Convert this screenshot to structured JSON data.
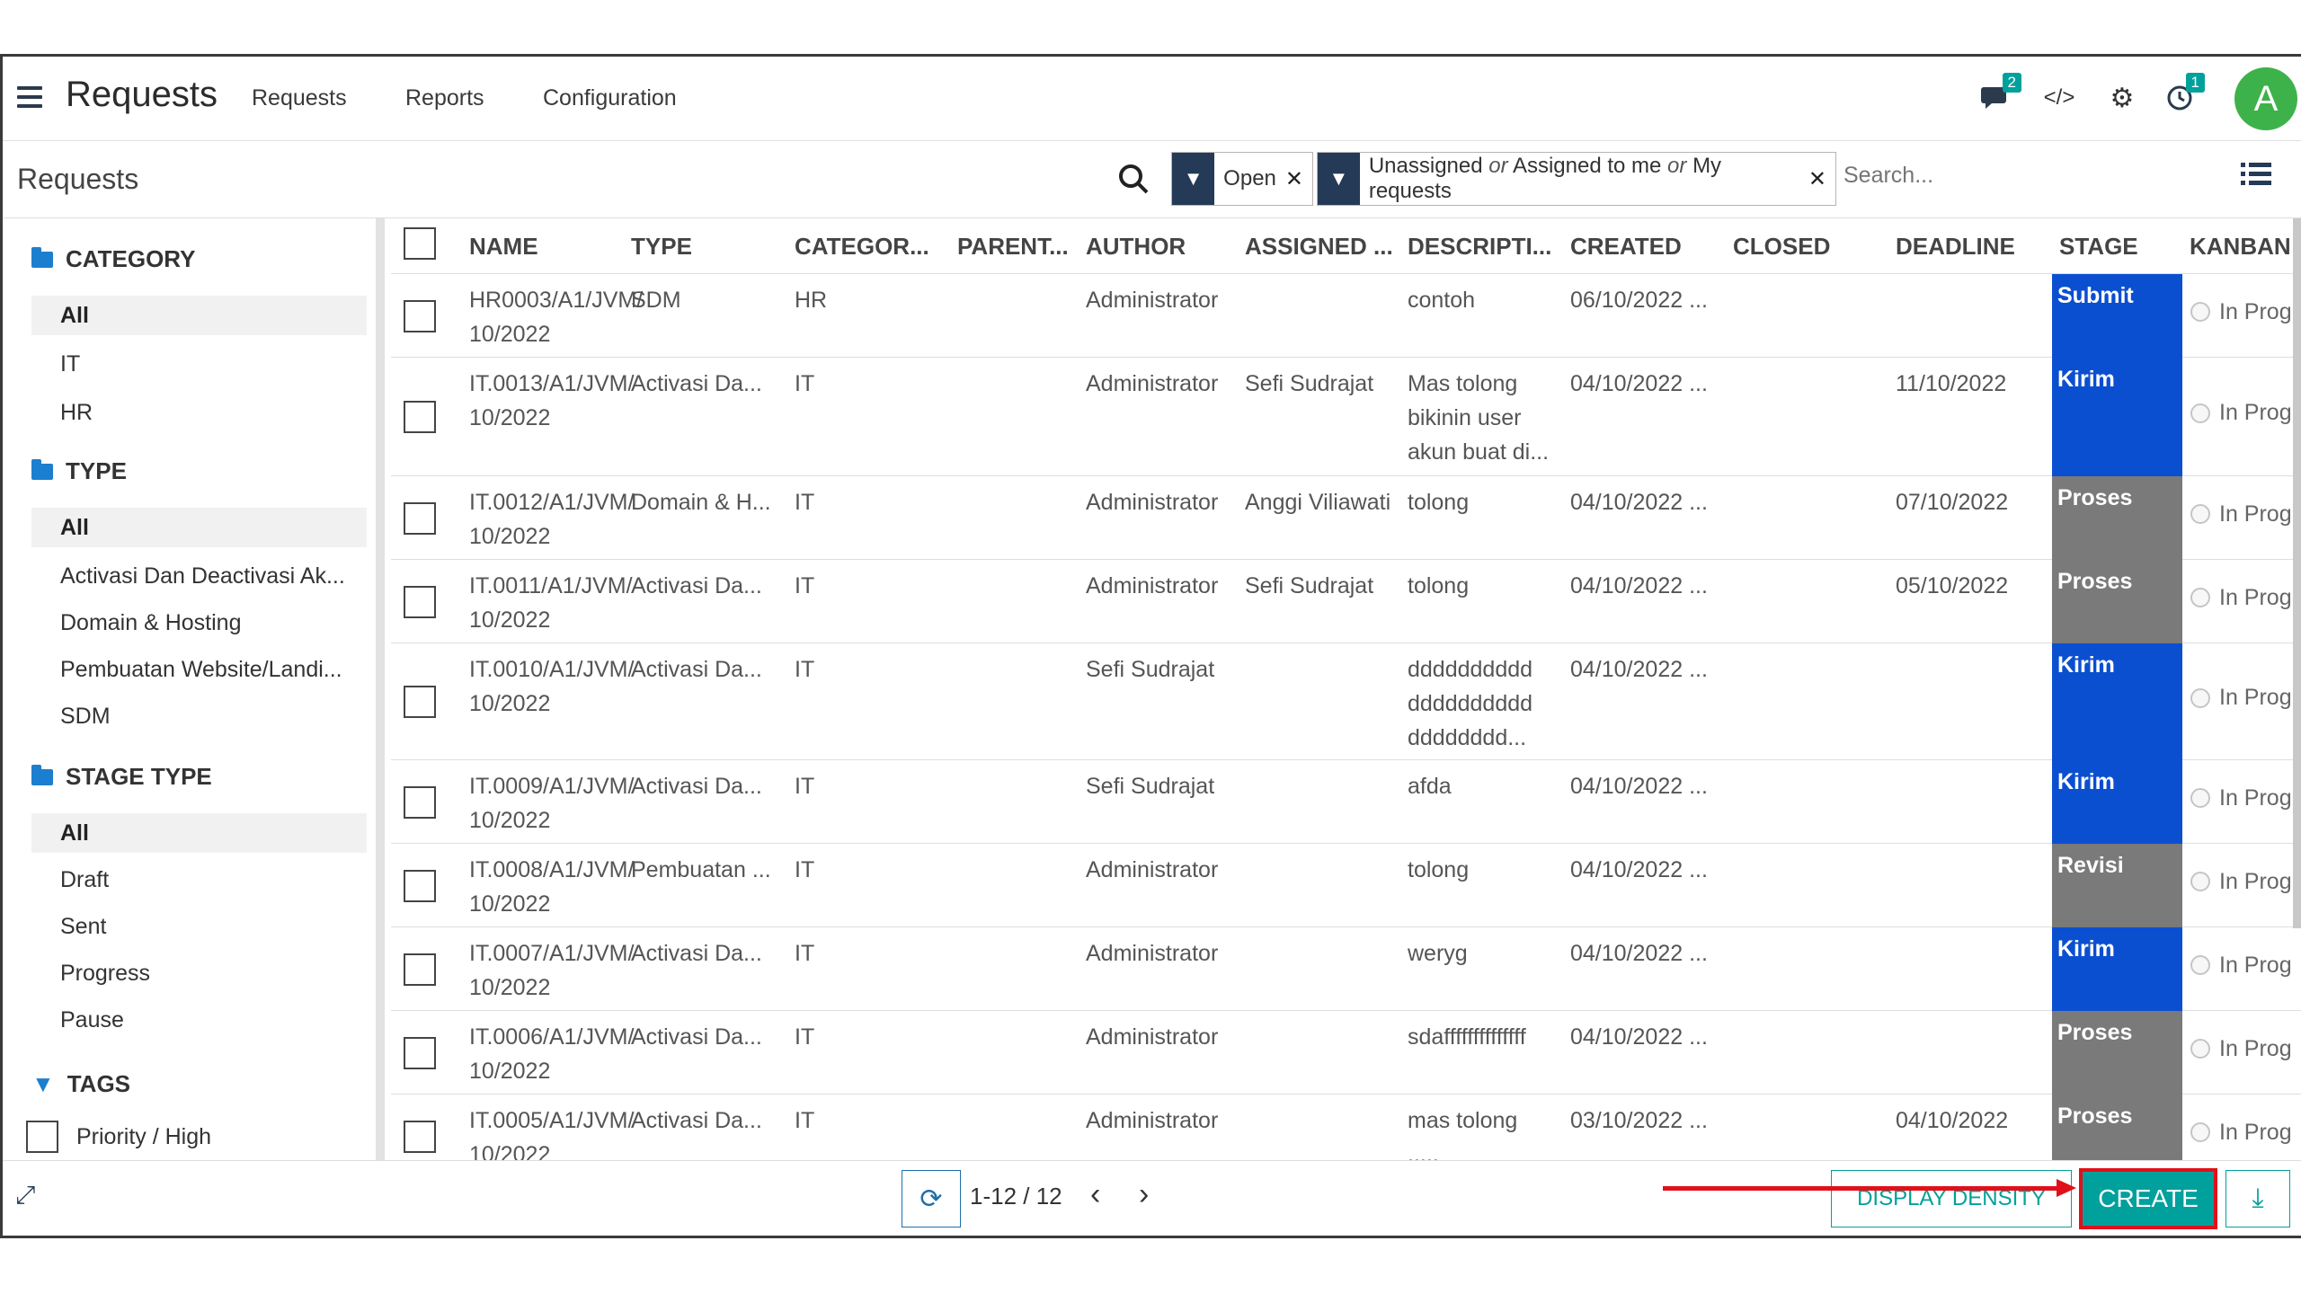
{
  "navbar": {
    "app_title": "Requests",
    "menu": [
      "Requests",
      "Reports",
      "Configuration"
    ],
    "chat_badge": "2",
    "activity_badge": "1",
    "avatar_letter": "A"
  },
  "control": {
    "breadcrumb": "Requests",
    "facet_open": "Open",
    "facet_assign": {
      "part1": "Unassigned",
      "or1": "or",
      "part2": "Assigned to me",
      "or2": "or",
      "part3": "My requests"
    },
    "search_placeholder": "Search..."
  },
  "sidebar": {
    "category_title": "CATEGORY",
    "category_items": [
      "All",
      "IT",
      "HR"
    ],
    "type_title": "TYPE",
    "type_items": [
      "All",
      "Activasi Dan Deactivasi Ak...",
      "Domain & Hosting",
      "Pembuatan Website/Landi...",
      "SDM"
    ],
    "stage_type_title": "STAGE TYPE",
    "stage_type_items": [
      "All",
      "Draft",
      "Sent",
      "Progress",
      "Pause"
    ],
    "tags_title": "TAGS",
    "tag_items": [
      "Priority / High"
    ]
  },
  "table": {
    "columns": [
      "NAME",
      "TYPE",
      "CATEGOR...",
      "PARENT...",
      "AUTHOR",
      "ASSIGNED ...",
      "DESCRIPTI...",
      "CREATED",
      "CLOSED",
      "DEADLINE",
      "STAGE",
      "KANBAN"
    ],
    "rows": [
      {
        "name1": "HR0003/A1/JVM/",
        "name2": "10/2022",
        "type": "SDM",
        "category": "HR",
        "author": "Administrator",
        "assigned": "",
        "desc": [
          "contoh"
        ],
        "created": "06/10/2022 ...",
        "deadline": "",
        "stage": "Submit",
        "stage_color": "blue",
        "kanban": "In Prog"
      },
      {
        "name1": "IT.0013/A1/JVM/",
        "name2": "10/2022",
        "type": "Activasi Da...",
        "category": "IT",
        "author": "Administrator",
        "assigned": "Sefi Sudrajat",
        "desc": [
          "Mas tolong",
          "bikinin user",
          "akun buat di..."
        ],
        "created": "04/10/2022 ...",
        "deadline": "11/10/2022",
        "stage": "Kirim",
        "stage_color": "blue",
        "kanban": "In Prog"
      },
      {
        "name1": "IT.0012/A1/JVM/",
        "name2": "10/2022",
        "type": "Domain & H...",
        "category": "IT",
        "author": "Administrator",
        "assigned": "Anggi Viliawati",
        "desc": [
          "tolong"
        ],
        "created": "04/10/2022 ...",
        "deadline": "07/10/2022",
        "stage": "Proses",
        "stage_color": "gray",
        "kanban": "In Prog"
      },
      {
        "name1": "IT.0011/A1/JVM/",
        "name2": "10/2022",
        "type": "Activasi Da...",
        "category": "IT",
        "author": "Administrator",
        "assigned": "Sefi Sudrajat",
        "desc": [
          "tolong"
        ],
        "created": "04/10/2022 ...",
        "deadline": "05/10/2022",
        "stage": "Proses",
        "stage_color": "gray",
        "kanban": "In Prog"
      },
      {
        "name1": "IT.0010/A1/JVM/",
        "name2": "10/2022",
        "type": "Activasi Da...",
        "category": "IT",
        "author": "Sefi Sudrajat",
        "assigned": "",
        "desc": [
          "dddddddddd",
          "dddddddddd",
          "dddddddd..."
        ],
        "created": "04/10/2022 ...",
        "deadline": "",
        "stage": "Kirim",
        "stage_color": "blue",
        "kanban": "In Prog"
      },
      {
        "name1": "IT.0009/A1/JVM/",
        "name2": "10/2022",
        "type": "Activasi Da...",
        "category": "IT",
        "author": "Sefi Sudrajat",
        "assigned": "",
        "desc": [
          "afda"
        ],
        "created": "04/10/2022 ...",
        "deadline": "",
        "stage": "Kirim",
        "stage_color": "blue",
        "kanban": "In Prog"
      },
      {
        "name1": "IT.0008/A1/JVM/",
        "name2": "10/2022",
        "type": "Pembuatan ...",
        "category": "IT",
        "author": "Administrator",
        "assigned": "",
        "desc": [
          "tolong"
        ],
        "created": "04/10/2022 ...",
        "deadline": "",
        "stage": "Revisi",
        "stage_color": "gray",
        "kanban": "In Prog"
      },
      {
        "name1": "IT.0007/A1/JVM/",
        "name2": "10/2022",
        "type": "Activasi Da...",
        "category": "IT",
        "author": "Administrator",
        "assigned": "",
        "desc": [
          "weryg"
        ],
        "created": "04/10/2022 ...",
        "deadline": "",
        "stage": "Kirim",
        "stage_color": "blue",
        "kanban": "In Prog"
      },
      {
        "name1": "IT.0006/A1/JVM/",
        "name2": "10/2022",
        "type": "Activasi Da...",
        "category": "IT",
        "author": "Administrator",
        "assigned": "",
        "desc": [
          "sdaffffffffffffff"
        ],
        "created": "04/10/2022 ...",
        "deadline": "",
        "stage": "Proses",
        "stage_color": "gray",
        "kanban": "In Prog"
      },
      {
        "name1": "IT.0005/A1/JVM/",
        "name2": "10/2022",
        "type": "Activasi Da...",
        "category": "IT",
        "author": "Administrator",
        "assigned": "",
        "desc": [
          "mas tolong",
          "....."
        ],
        "created": "03/10/2022 ...",
        "deadline": "04/10/2022",
        "stage": "Proses",
        "stage_color": "gray",
        "kanban": "In Prog"
      }
    ]
  },
  "footer": {
    "pager": "1-12 / 12",
    "density_label": "DISPLAY DENSITY",
    "create_label": "CREATE"
  },
  "colors": {
    "brand_teal": "#00a09d",
    "stage_blue": "#0b4fd1",
    "stage_gray": "#7a7a7a",
    "annotation_red": "#e0111a"
  }
}
